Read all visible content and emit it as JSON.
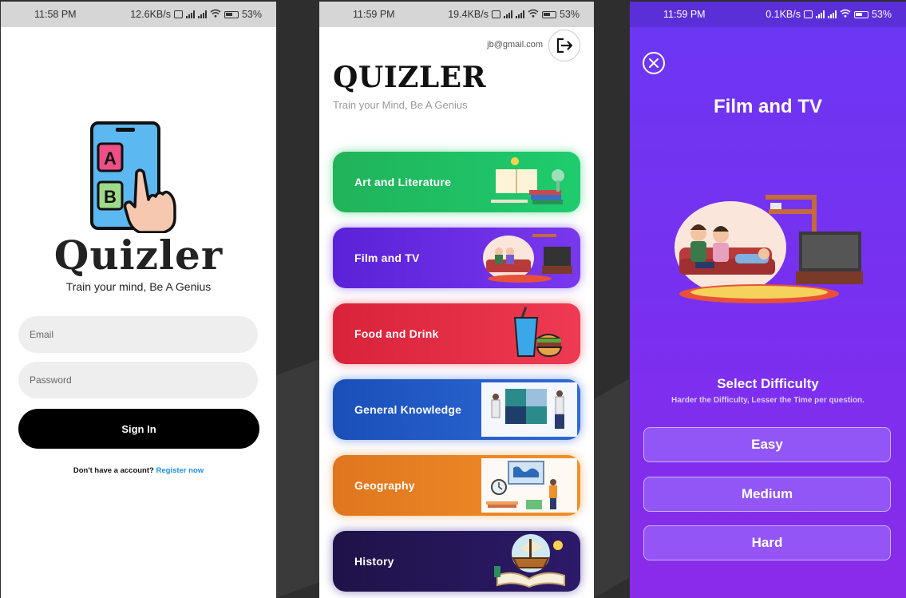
{
  "screens": {
    "login": {
      "status": {
        "time": "11:58 PM",
        "speed": "12.6KB/s",
        "battery": "53%"
      },
      "brand_title": "Quizler",
      "tagline": "Train your mind, Be A Genius",
      "illustration": {
        "letter_a": "A",
        "letter_b": "B"
      },
      "email_placeholder": "Email",
      "password_placeholder": "Password",
      "sign_in_label": "Sign In",
      "register_prompt": "Don't have a account?",
      "register_link": "Register now"
    },
    "categories": {
      "status": {
        "time": "11:59 PM",
        "speed": "19.4KB/s",
        "battery": "53%"
      },
      "user_email": "jb@gmail.com",
      "title": "QUIZLER",
      "tagline": "Train your Mind, Be A Genius",
      "items": [
        {
          "label": "Art and Literature",
          "color": "#1ec46a"
        },
        {
          "label": "Film and TV",
          "color": "#6a2fe8"
        },
        {
          "label": "Food and Drink",
          "color": "#e52f48"
        },
        {
          "label": "General Knowledge",
          "color": "#2660cc"
        },
        {
          "label": "Geography",
          "color": "#ea8524"
        },
        {
          "label": "History",
          "color": "#27175c"
        }
      ]
    },
    "difficulty": {
      "status": {
        "time": "11:59 PM",
        "speed": "0.1KB/s",
        "battery": "53%"
      },
      "category_title": "Film and TV",
      "heading": "Select Difficulty",
      "subtitle": "Harder the Difficulty, Lesser the Time per question.",
      "options": [
        {
          "label": "Easy"
        },
        {
          "label": "Medium"
        },
        {
          "label": "Hard"
        }
      ]
    }
  },
  "icons": [
    "logout-icon",
    "close-icon",
    "wifi-icon",
    "battery-icon",
    "signal-icon"
  ],
  "colors": {
    "accent_purple": "#7a2ff0",
    "link_blue": "#1f8fe6",
    "login_button": "#000000"
  }
}
